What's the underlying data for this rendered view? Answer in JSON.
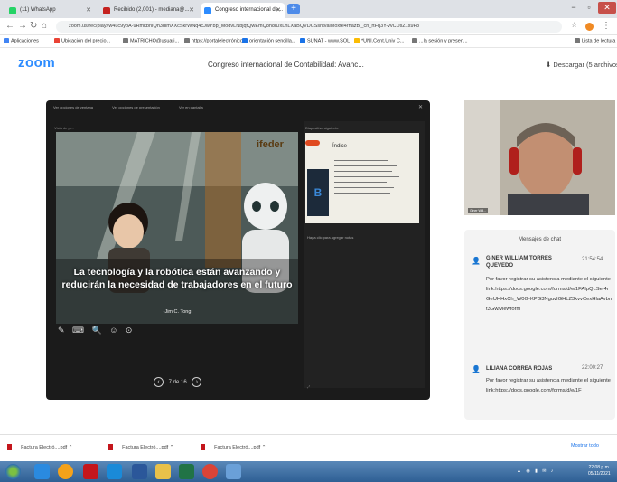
{
  "browser": {
    "tabs": [
      {
        "label": "(11) WhatsApp",
        "active": false,
        "favicon_color": "#25d366"
      },
      {
        "label": "Recibido (2,001) - mediana@...",
        "active": false,
        "favicon_color": "#c5221f"
      },
      {
        "label": "Congreso internacional de...",
        "active": true,
        "favicon_color": "#2d8cff"
      }
    ],
    "new_tab_label": "+",
    "url": "zoom.us/rec/play/lw4uc9yoA-9RmkbnIQh3dlmXXcSkrWNq4cJwYbp_ModvLNbjqfQwEmQ8h8IUxLnLXaBQVDCSsntvalMoxfe4rhazBj_cn_rtFrj3Y-vvCDsZ1s9F8"
  },
  "bookmarks": [
    {
      "label": "Aplicaciones",
      "color": "#4285f4"
    },
    {
      "label": "Ubicación del precio...",
      "color": "#ea4335"
    },
    {
      "label": "MATRICHO@usuari...",
      "color": "#777777"
    },
    {
      "label": "https://portalelectrónico...",
      "color": "#777777"
    },
    {
      "label": "orientación sencilla...",
      "color": "#1a73e8"
    },
    {
      "label": "SUNAT - www.SOL",
      "color": "#1a73e8"
    },
    {
      "label": "*UNI.Cent.Univ C...",
      "color": "#fbbc04"
    },
    {
      "label": "...la sesión y presen...",
      "color": "#777777"
    },
    {
      "label": "Lista de lectura",
      "color": "#777777"
    }
  ],
  "zoom": {
    "logo": "zoom",
    "meeting_title": "Congreso internacional de Contabilidad: Avanc...",
    "download_label": "Descargar (5 archivos)"
  },
  "player": {
    "toolbar": [
      "Ver opciones de ventana",
      "Ver opciones de presentación",
      "Ver en pantalla"
    ],
    "share_label": "Vista de pr...",
    "slide_brand": "ifeder",
    "slide_caption": "La tecnología y la robótica están avanzando y reducirán la necesidad de trabajadores en el futuro",
    "slide_citation": "-Jim C. Tong",
    "side_title": "Diapositiva siguiente",
    "side_label": "Haga clic para agregar notas",
    "thumb_title": "Índice",
    "thumb_letter": "B",
    "slide_tools": "✎ ⌨ 🔍 ☺ ⊙",
    "slide_counter": "7 de 16",
    "prev_label": "‹",
    "next_label": "›"
  },
  "webcam": {
    "name_label": "Giner Will..."
  },
  "chat": {
    "header": "Mensajes de chat",
    "messages": [
      {
        "name": "GINER WILLIAM TORRES QUEVEDO",
        "time": "21:54:54",
        "text": "Por favor registrar su asistencia mediante el siguiente link:https://docs.google.com/forms/d/e/1FAIpQLSeI4rGeUHHxCh_W0G-KPG3NguvIGHLZ3kvvCexHlaAvbnt3Gw/viewform"
      },
      {
        "name": "LILIANA CORREA ROJAS",
        "time": "22:00:27",
        "text": "Por favor registrar su asistencia mediante el siguiente link:https://docs.google.com/forms/d/e/1F"
      }
    ]
  },
  "downloads": {
    "items": [
      "__Factura Electró....pdf",
      "__Factura Electró....pdf",
      "__Factura Electró....pdf"
    ],
    "show_all": "Mostrar todo"
  },
  "taskbar": {
    "clock_time": "22:08 p.m.",
    "clock_date": "05/11/2021"
  }
}
